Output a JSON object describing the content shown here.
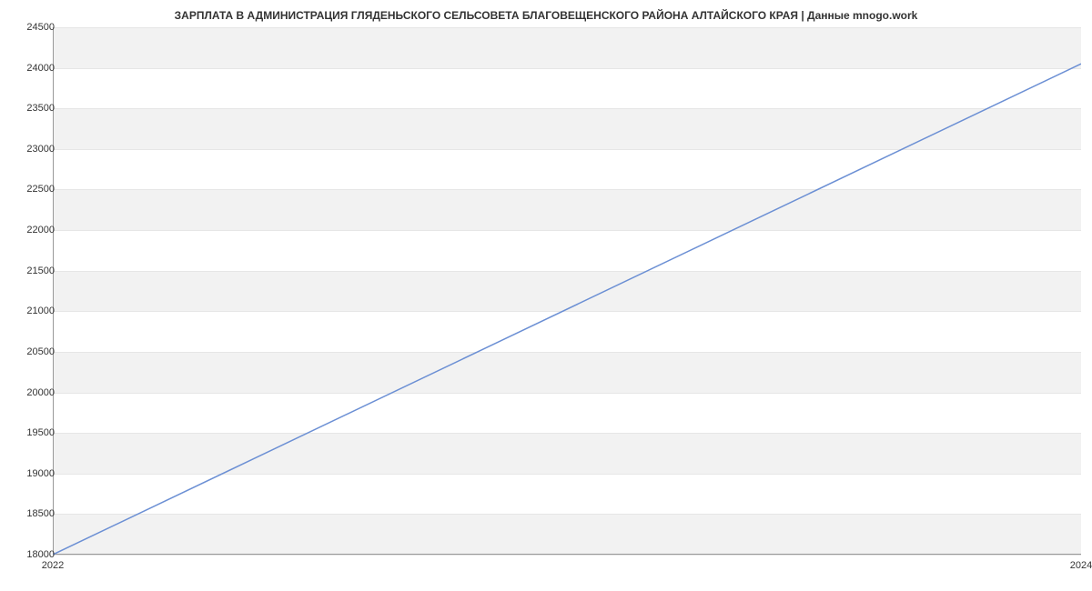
{
  "chart_data": {
    "type": "line",
    "title": "ЗАРПЛАТА В АДМИНИСТРАЦИЯ ГЛЯДЕНЬСКОГО СЕЛЬСОВЕТА БЛАГОВЕЩЕНСКОГО РАЙОНА АЛТАЙСКОГО КРАЯ | Данные mnogo.work",
    "x": [
      2022,
      2024
    ],
    "values": [
      18000,
      24050
    ],
    "xlabel": "",
    "ylabel": "",
    "xlim": [
      2022,
      2024
    ],
    "ylim": [
      18000,
      24500
    ],
    "y_ticks": [
      18000,
      18500,
      19000,
      19500,
      20000,
      20500,
      21000,
      21500,
      22000,
      22500,
      23000,
      23500,
      24000,
      24500
    ],
    "x_ticks": [
      2022,
      2024
    ]
  }
}
